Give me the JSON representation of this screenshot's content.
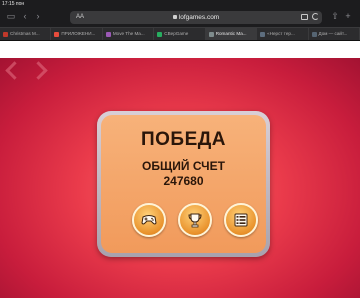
{
  "status_bar": {
    "time": "17:15 пон"
  },
  "browser": {
    "reader_label": "AA",
    "url": "lofgames.com",
    "tabs": [
      {
        "label": "Christmas M...",
        "favicon_color": "#c0392b",
        "active": false
      },
      {
        "label": "ПРИЛОЖЕНИ...",
        "favicon_color": "#e74c3c",
        "active": false
      },
      {
        "label": "Move The Ma...",
        "favicon_color": "#9b59b6",
        "active": false
      },
      {
        "label": "CBepGame",
        "favicon_color": "#27ae60",
        "active": false
      },
      {
        "label": "Romantic Ma...",
        "favicon_color": "#7f8c8d",
        "active": true
      },
      {
        "label": "«Нерст тер...",
        "favicon_color": "#5d6d7e",
        "active": false
      },
      {
        "label": "Дом — сайт...",
        "favicon_color": "#566573",
        "active": false
      }
    ]
  },
  "game": {
    "title": "ПОБЕДА",
    "score_label": "ОБЩИЙ СЧЕТ",
    "score_value": "247680",
    "buttons": [
      "gamepad-icon",
      "trophy-icon",
      "list-icon"
    ]
  },
  "colors": {
    "panel": "#f4a66a",
    "background": "#e0344a",
    "button": "#f2a23f"
  }
}
